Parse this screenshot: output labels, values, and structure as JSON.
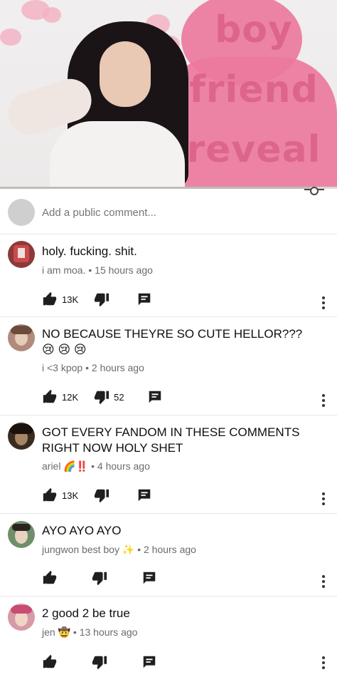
{
  "video": {
    "overlay_lines": [
      "boy",
      "friend",
      "reveal"
    ],
    "progress_fraction": 0.92
  },
  "add_comment": {
    "placeholder": "Add a public comment..."
  },
  "comments": [
    {
      "text": "holy. fucking. shit.",
      "author": "i am moa.",
      "time": "15 hours ago",
      "likes": "13K",
      "dislikes": "",
      "avatar_color": "#8b3a3a"
    },
    {
      "text": "NO BECAUSE THEYRE SO CUTE HELLOR??? 😢 😢 😢",
      "author": "i <3 kpop",
      "time": "2 hours ago",
      "likes": "12K",
      "dislikes": "52",
      "avatar_color": "#b08a7a"
    },
    {
      "text": "GOT EVERY FANDOM IN THESE COMMENTS RIGHT NOW HOLY SHET",
      "author": "ariel 🌈‼️",
      "time": "4 hours ago",
      "likes": "13K",
      "dislikes": "",
      "avatar_color": "#3a2b1f"
    },
    {
      "text": "AYO AYO AYO",
      "author": "jungwon best boy ✨",
      "time": "2 hours ago",
      "likes": "",
      "dislikes": "",
      "avatar_color": "#6f8f6a"
    },
    {
      "text": "2 good 2 be true",
      "author": "jen 🤠",
      "time": "13 hours ago",
      "likes": "",
      "dislikes": "",
      "avatar_color": "#d79aa7"
    }
  ],
  "separator": "•"
}
